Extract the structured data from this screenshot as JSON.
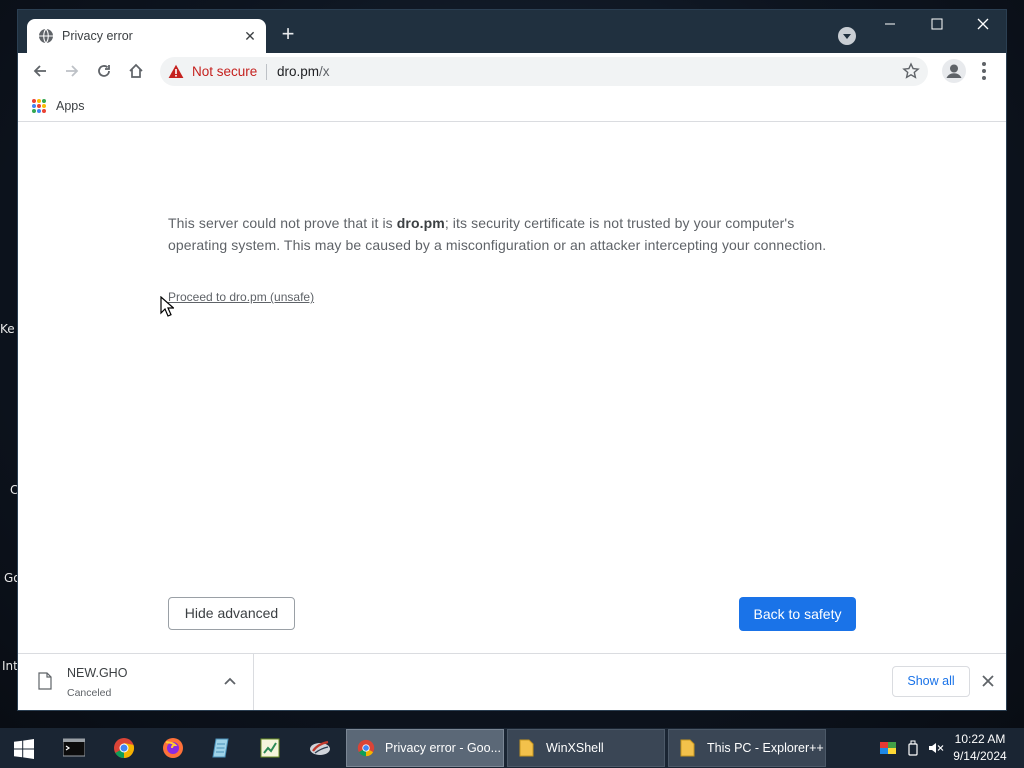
{
  "desktop": {
    "labels": [
      "Ke",
      "C",
      "Go",
      "Int"
    ]
  },
  "browser": {
    "tab": {
      "title": "Privacy error",
      "favicon": "globe-icon"
    },
    "window_controls": [
      "minimize",
      "maximize",
      "close"
    ],
    "omnibox": {
      "security_label": "Not secure",
      "url_host": "dro.pm",
      "url_path": "/x"
    },
    "bookmarks": {
      "apps_label": "Apps"
    },
    "colors": {
      "accent": "#1a73e8",
      "warning": "#c5221f",
      "titlebar": "#20303f"
    }
  },
  "interstitial": {
    "advanced_text_1": "This server could not prove that it is ",
    "advanced_host": "dro.pm",
    "advanced_text_2": "; its security certificate is not trusted by your computer's operating system. This may be caused by a misconfiguration or an attacker intercepting your connection.",
    "proceed_link": "Proceed to dro.pm (unsafe)",
    "hide_advanced_label": "Hide advanced",
    "back_to_safety_label": "Back to safety"
  },
  "downloads": {
    "file_name": "NEW.GHO",
    "status": "Canceled",
    "show_all_label": "Show all"
  },
  "taskbar": {
    "pinned": [
      "terminal-icon",
      "chrome-icon",
      "firefox-icon",
      "notepad-icon",
      "spreadsheet-icon",
      "tool-icon"
    ],
    "tasks": [
      {
        "label": "Privacy error - Goo...",
        "icon": "chrome-icon",
        "active": true
      },
      {
        "label": "WinXShell",
        "icon": "folder-icon",
        "active": false
      },
      {
        "label": "This PC - Explorer++",
        "icon": "folder-icon",
        "active": false
      }
    ],
    "clock": {
      "time": "10:22 AM",
      "date": "9/14/2024"
    }
  }
}
